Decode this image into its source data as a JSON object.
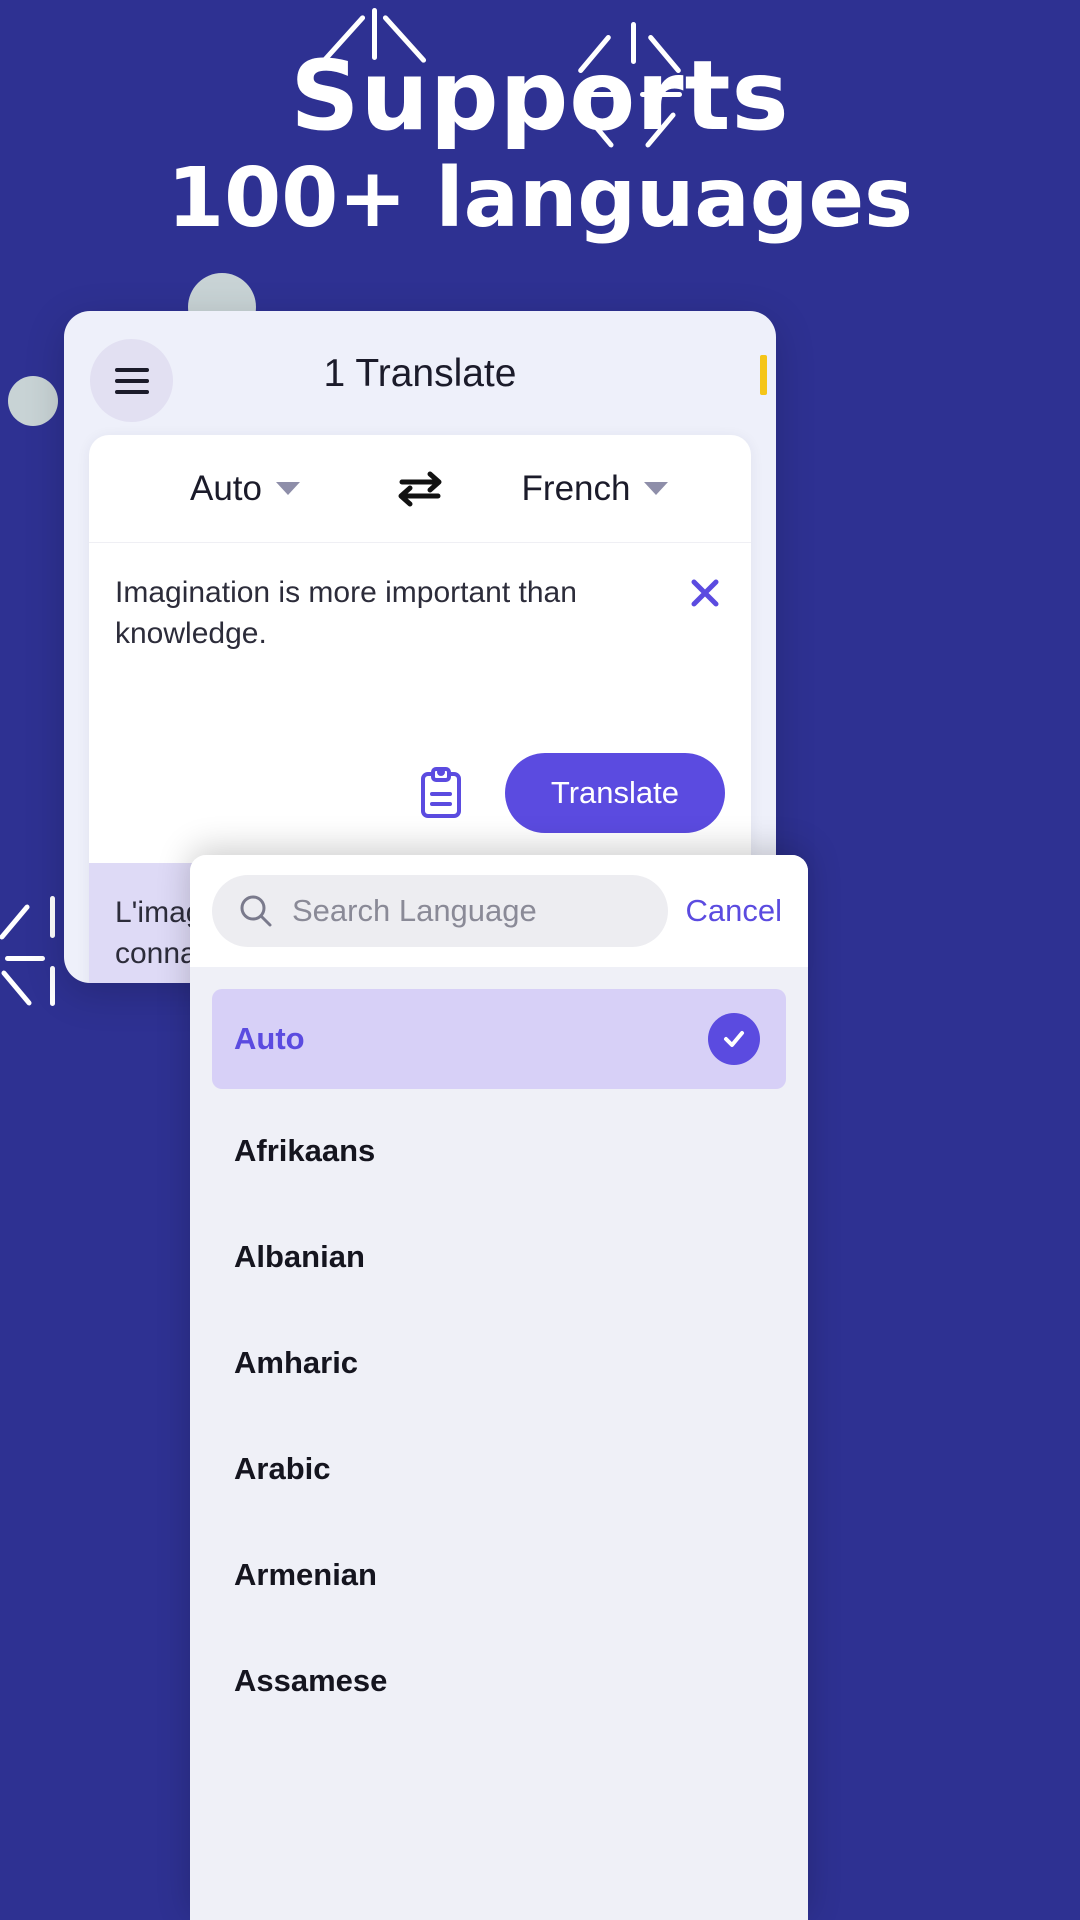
{
  "theme": {
    "background": "#2E3192",
    "accent_purple": "#5B4BE0",
    "card_bg": "#EEF0FA",
    "result_bg": "#DEDAF6",
    "selected_bg": "#D7D0F7",
    "header_accent": "#F5C518"
  },
  "headline": {
    "line1": "Supports",
    "line2": "100+ languages"
  },
  "app": {
    "title": "1 Translate",
    "menu_icon": "hamburger-menu-icon",
    "accent_icon": "bookmark-accent"
  },
  "translate": {
    "source_language": "Auto",
    "target_language": "French",
    "swap_icon": "swap-arrows-icon",
    "caret_icon": "chevron-down-icon",
    "input_text": "Imagination is more important than knowledge.",
    "clear_icon": "close-icon",
    "paste_icon": "clipboard-icon",
    "translate_label": "Translate",
    "result_text": "L'imagination est plus important que la connaissance."
  },
  "sheet": {
    "search_placeholder": "Search Language",
    "search_value": "",
    "search_icon": "search-icon",
    "cancel_label": "Cancel",
    "check_icon": "check-circle-icon",
    "languages": [
      {
        "name": "Auto",
        "selected": true
      },
      {
        "name": "Afrikaans",
        "selected": false
      },
      {
        "name": "Albanian",
        "selected": false
      },
      {
        "name": "Amharic",
        "selected": false
      },
      {
        "name": "Arabic",
        "selected": false
      },
      {
        "name": "Armenian",
        "selected": false
      },
      {
        "name": "Assamese",
        "selected": false
      }
    ]
  }
}
